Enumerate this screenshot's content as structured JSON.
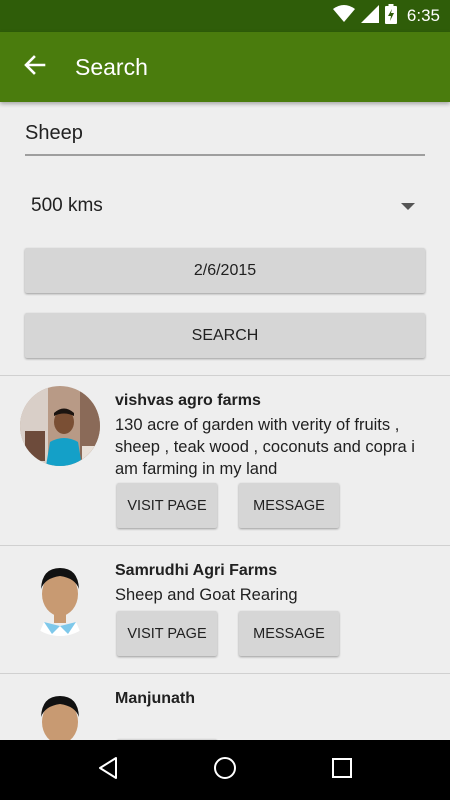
{
  "status_bar": {
    "time": "6:35"
  },
  "app_bar": {
    "title": "Search"
  },
  "search": {
    "query": "Sheep"
  },
  "distance": {
    "selected": "500 kms"
  },
  "date_button": {
    "label": "2/6/2015"
  },
  "search_button": {
    "label": "SEARCH"
  },
  "results": [
    {
      "name": "vishvas agro farms",
      "description": "130  acre of garden with verity of fruits , sheep ,  teak wood , coconuts and copra i am farming in my land",
      "visit_label": "VISIT PAGE",
      "message_label": "MESSAGE"
    },
    {
      "name": "Samrudhi Agri Farms",
      "description": "Sheep and Goat Rearing",
      "visit_label": "VISIT PAGE",
      "message_label": "MESSAGE"
    },
    {
      "name": "Manjunath",
      "description": ""
    }
  ],
  "colors": {
    "status_bar": "#2f5d09",
    "app_bar": "#4a7c0d",
    "background": "#eeeeee",
    "button": "#d6d6d6"
  },
  "icons": [
    "wifi-icon",
    "signal-icon",
    "battery-icon",
    "back-arrow-icon",
    "nav-back-icon",
    "nav-home-icon",
    "nav-recents-icon",
    "dropdown-arrow-icon"
  ]
}
